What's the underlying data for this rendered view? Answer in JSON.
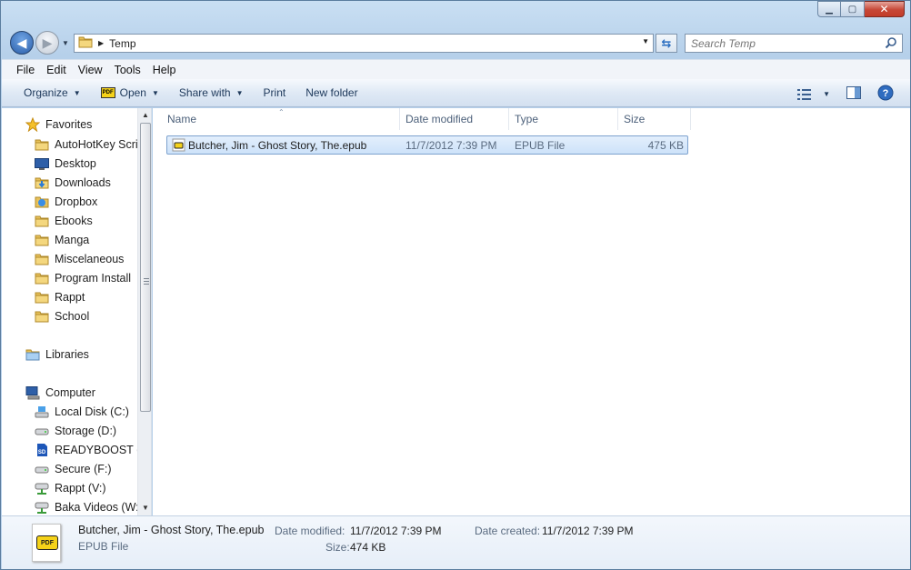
{
  "window": {
    "minimize_glyph": "▁",
    "maximize_glyph": "▢",
    "close_glyph": "✕"
  },
  "address": {
    "path": "Temp"
  },
  "search": {
    "placeholder": "Search Temp"
  },
  "menu": [
    "File",
    "Edit",
    "View",
    "Tools",
    "Help"
  ],
  "toolbar": {
    "organize": "Organize",
    "open": "Open",
    "share_with": "Share with",
    "print": "Print",
    "new_folder": "New folder",
    "open_icon_text": "PDF"
  },
  "nav": {
    "favorites": "Favorites",
    "favorites_items": [
      "AutoHotKey Scrip",
      "Desktop",
      "Downloads",
      "Dropbox",
      "Ebooks",
      "Manga",
      "Miscelaneous",
      "Program Install",
      "Rappt",
      "School"
    ],
    "libraries": "Libraries",
    "computer": "Computer",
    "computer_items": [
      "Local Disk (C:)",
      "Storage (D:)",
      "READYBOOST (E:",
      "Secure (F:)",
      "Rappt (V:)",
      "Baka Videos (W:)"
    ]
  },
  "columns": {
    "name": "Name",
    "date_modified": "Date modified",
    "type": "Type",
    "size": "Size"
  },
  "files": [
    {
      "name": "Butcher, Jim - Ghost Story, The.epub",
      "date_modified": "11/7/2012 7:39 PM",
      "type": "EPUB File",
      "size": "475 KB"
    }
  ],
  "details": {
    "filename": "Butcher, Jim - Ghost Story, The.epub",
    "filetype": "EPUB File",
    "date_modified_label": "Date modified:",
    "date_modified_value": "11/7/2012 7:39 PM",
    "size_label": "Size:",
    "size_value": "474 KB",
    "date_created_label": "Date created:",
    "date_created_value": "11/7/2012 7:39 PM",
    "icon_text": "PDF"
  },
  "colors": {
    "selection": "#cde2f9",
    "selection_border": "#7da2ce",
    "command_text": "#1e395b"
  }
}
